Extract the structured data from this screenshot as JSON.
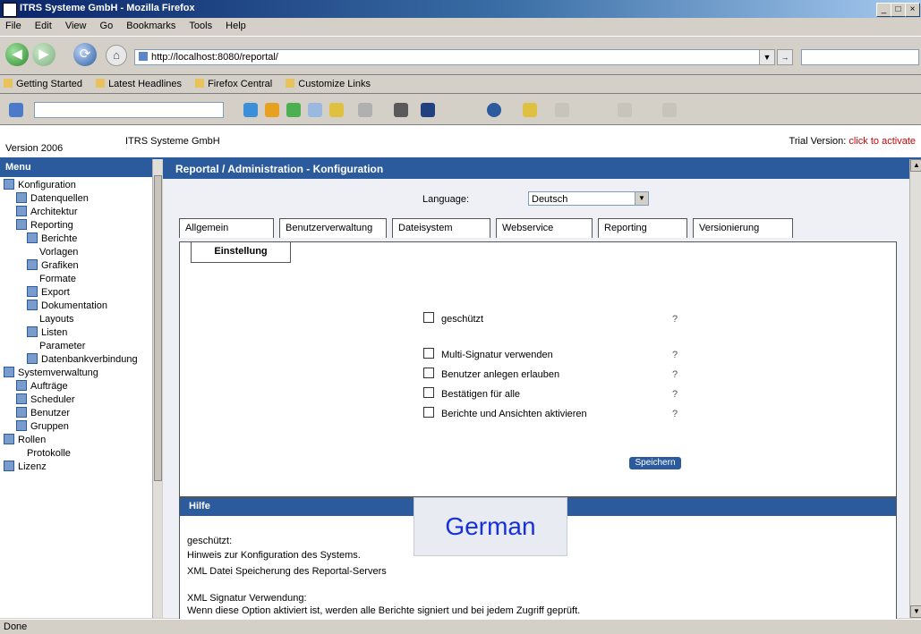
{
  "window": {
    "title": "ITRS Systeme GmbH - Mozilla Firefox",
    "controls": [
      "_",
      "□",
      "×"
    ]
  },
  "menubar": {
    "items": [
      "File",
      "Edit",
      "View",
      "Go",
      "Bookmarks",
      "Tools",
      "Help"
    ]
  },
  "navbar": {
    "url": "http://localhost:8080/reportal/",
    "search_placeholder": ""
  },
  "bookmarks": {
    "items": [
      "Getting Started",
      "Latest Headlines",
      "Firefox Central",
      "Customize Links"
    ]
  },
  "appheader": {
    "left": "Version 2006",
    "mid": "ITRS Systeme GmbH",
    "right_prefix": "Trial Version:",
    "right_link": "click to activate"
  },
  "sidebar": {
    "title": "Menu",
    "items": [
      "Konfiguration",
      "Datenquellen",
      "Architektur",
      "Reporting",
      "Berichte",
      "Vorlagen",
      "Grafiken",
      "Formate",
      "Export",
      "Dokumentation",
      "Layouts",
      "Listen",
      "Parameter",
      "Datenbankverbindung",
      "Systemverwaltung",
      "Aufträge",
      "Scheduler",
      "Benutzer",
      "Gruppen",
      "Rollen",
      "Protokolle",
      "Lizenz"
    ]
  },
  "main": {
    "header": "Reportal / Administration - Konfiguration",
    "language_label": "Language:",
    "language_value": "Deutsch",
    "tabs": [
      "Allgemein",
      "Benutzerverwaltung",
      "Dateisystem",
      "Webservice",
      "Reporting",
      "Versionierung"
    ],
    "subtab": "Einstellung",
    "options": [
      "geschützt",
      "Multi-Signatur verwenden",
      "Benutzer anlegen erlauben",
      "Bestätigen für alle",
      "Berichte und Ansichten aktivieren"
    ],
    "ok_label": "Speichern"
  },
  "help": {
    "title": "Hilfe",
    "lines": [
      "geschützt:",
      "Hinweis zur Konfiguration des Systems.",
      "XML Datei Speicherung des Reportal-Servers",
      "XML Signatur Verwendung:",
      "Wenn diese Option aktiviert ist, werden alle Berichte signiert und bei jedem Zugriff geprüft."
    ]
  },
  "overlay": {
    "label": "German"
  },
  "statusbar": {
    "status": "Done",
    "zone": ""
  },
  "colors": {
    "accent": "#2c5b9d",
    "link": "#cc0000",
    "overlay_text": "#1530e0"
  }
}
